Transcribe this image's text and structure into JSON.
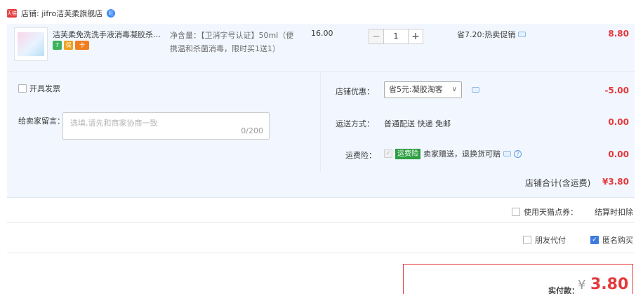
{
  "store": {
    "badge": "天猫",
    "name": "店铺: jifro洁芙柔旗舰店",
    "ww": "旺"
  },
  "item": {
    "title": "洁芙柔免洗洗手液消毒凝胶杀菌抑菌",
    "badges": [
      "7",
      "保",
      "卡"
    ],
    "sku": "净含量：【卫消字号认证】50ml（便携温和杀菌消毒，限时买1送1）",
    "unit_price": "16.00",
    "quantity": "1",
    "minus": "−",
    "plus": "+",
    "promo": "省7.20:热卖促销",
    "subtotal": "8.80"
  },
  "invoice": {
    "label": "开具发票"
  },
  "message": {
    "label": "给卖家留言：",
    "placeholder": "选填,请先和商家协商一致",
    "counter": "0/200"
  },
  "discount": {
    "label": "店铺优惠：",
    "selected": "省5元:凝胶淘客",
    "value": "-5.00"
  },
  "shipping": {
    "label": "运送方式：",
    "method": "普通配送 快递 免邮",
    "price": "0.00"
  },
  "insurance": {
    "label": "运费险：",
    "tag": "运费险",
    "text": "卖家赠送，退换货可赔",
    "price": "0.00",
    "help": "?"
  },
  "store_total": {
    "label": "店铺合计(含运费)",
    "value": "¥3.80"
  },
  "points": {
    "label": "使用天猫点券：",
    "note": "结算时扣除"
  },
  "friend_pay": {
    "label": "朋友代付"
  },
  "anonymous": {
    "label": "匿名购买",
    "checked": true
  },
  "pay": {
    "label": "实付款：",
    "yen": "¥",
    "amount": "3.80"
  },
  "colors": {
    "accent": "#e4393c",
    "panel": "#f2f7ff",
    "link": "#3d8af7",
    "tag_green": "#2d9e42"
  }
}
